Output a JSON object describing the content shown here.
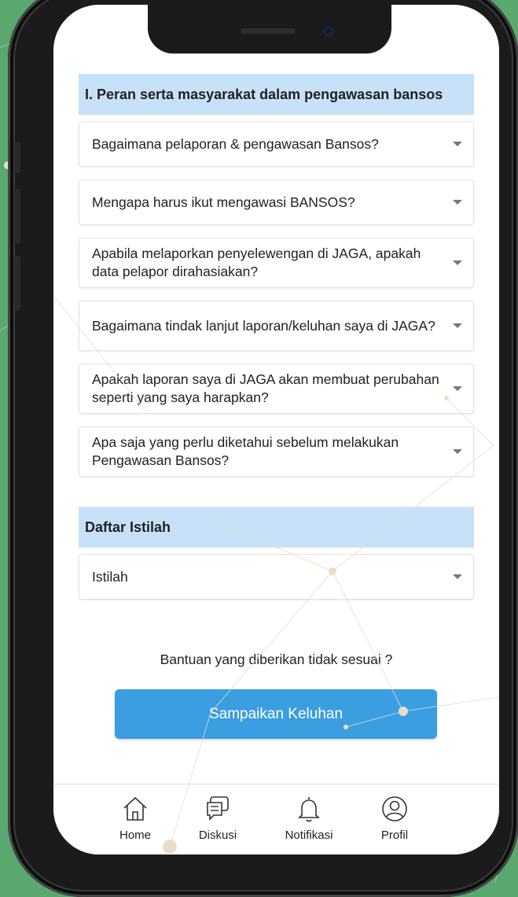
{
  "section_peran": {
    "title": "I. Peran serta masyarakat dalam pengawasan bansos",
    "items": [
      {
        "label": "Bagaimana pelaporan & pengawasan Bansos?"
      },
      {
        "label": "Mengapa harus ikut mengawasi BANSOS?"
      },
      {
        "label": "Apabila melaporkan penyelewengan di JAGA, apakah data pelapor dirahasiakan?"
      },
      {
        "label": "Bagaimana tindak lanjut laporan/keluhan saya di JAGA?"
      },
      {
        "label": "Apakah laporan saya di JAGA akan membuat perubahan seperti yang saya harapkan?"
      },
      {
        "label": "Apa saja yang perlu diketahui sebelum melakukan Pengawasan Bansos?"
      }
    ]
  },
  "section_istilah": {
    "title": "Daftar Istilah",
    "items": [
      {
        "label": "Istilah"
      }
    ]
  },
  "help": {
    "question": "Bantuan yang diberikan tidak sesuai ?",
    "button_label": "Sampaikan Keluhan"
  },
  "bottom_nav": {
    "items": [
      {
        "label": "Home",
        "icon": "home-icon"
      },
      {
        "label": "Diskusi",
        "icon": "chat-icon"
      },
      {
        "label": "Notifikasi",
        "icon": "bell-icon"
      },
      {
        "label": "Profil",
        "icon": "profile-icon"
      }
    ]
  },
  "colors": {
    "background": "#5aa86f",
    "header_bg": "#c7e2f8",
    "button_bg": "#3a9ee0"
  }
}
